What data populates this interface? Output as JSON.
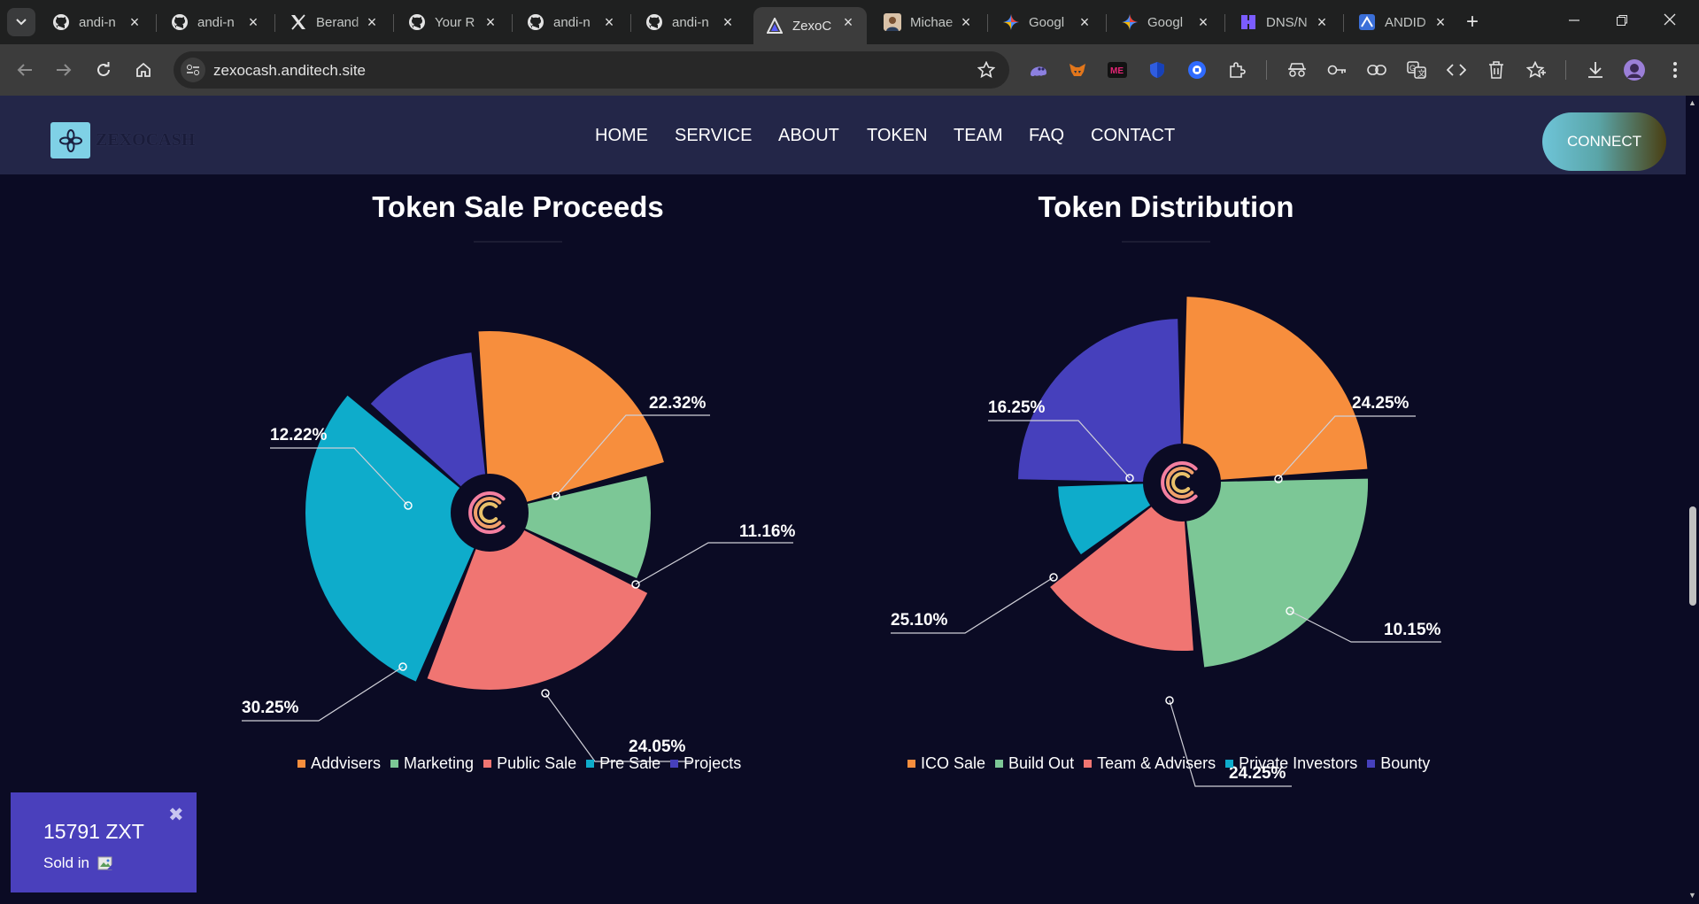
{
  "browser": {
    "tabs": [
      {
        "label": "andi-n",
        "icon": "github-icon"
      },
      {
        "label": "andi-n",
        "icon": "github-icon"
      },
      {
        "label": "Berand",
        "icon": "x-logo-icon"
      },
      {
        "label": "Your R",
        "icon": "github-icon"
      },
      {
        "label": "andi-n",
        "icon": "github-icon"
      },
      {
        "label": "andi-n",
        "icon": "github-icon"
      },
      {
        "label": "ZexoC",
        "icon": "zexo-tab-icon",
        "active": true
      },
      {
        "label": "Michae",
        "icon": "avatar-tab-icon"
      },
      {
        "label": "Googl",
        "icon": "gemini-icon"
      },
      {
        "label": "Googl",
        "icon": "gemini-icon"
      },
      {
        "label": "DNS/N",
        "icon": "dns-tab-icon"
      },
      {
        "label": "ANDID",
        "icon": "andid-tab-icon"
      }
    ],
    "url": "zexocash.anditech.site"
  },
  "site": {
    "logo_text": "ZEXOCASH",
    "nav": [
      "HOME",
      "SERVICE",
      "ABOUT",
      "TOKEN",
      "TEAM",
      "FAQ",
      "CONTACT"
    ],
    "connect_label": "CONNECT"
  },
  "colors": {
    "orange": "#f78e3d",
    "green": "#7cc796",
    "red": "#f07572",
    "cyan": "#0eaccb",
    "indigo": "#4640bc"
  },
  "chart_data": [
    {
      "type": "pie",
      "title": "Token Sale Proceeds",
      "categories": [
        "Addvisers",
        "Marketing",
        "Public Sale",
        "Pre Sale",
        "Projects"
      ],
      "values": [
        22.32,
        11.16,
        24.05,
        30.25,
        12.22
      ],
      "labels": [
        "22.32%",
        "11.16%",
        "24.05%",
        "30.25%",
        "12.22%"
      ],
      "colors": [
        "#f78e3d",
        "#7cc796",
        "#f07572",
        "#0eaccb",
        "#4640bc"
      ],
      "legend_position": "bottom"
    },
    {
      "type": "pie",
      "title": "Token Distribution",
      "categories": [
        "ICO Sale",
        "Build Out",
        "Team & Advisers",
        "Private Investors",
        "Bounty"
      ],
      "values": [
        24.25,
        24.25,
        16.25,
        10.15,
        25.1
      ],
      "labels": [
        "24.25%",
        "24.25%",
        "16.25%",
        "10.15%",
        "25.10%"
      ],
      "colors": [
        "#f78e3d",
        "#7cc796",
        "#f07572",
        "#0eaccb",
        "#4640bc"
      ],
      "legend_position": "bottom"
    }
  ],
  "sold_widget": {
    "amount": "15791 ZXT",
    "label": "Sold in",
    "close": "✖"
  }
}
